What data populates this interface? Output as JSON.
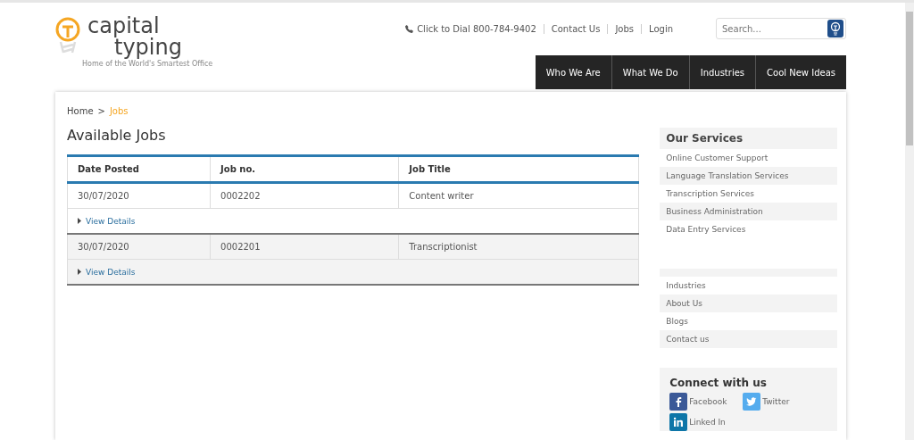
{
  "logo": {
    "word_1": "capital",
    "word_2": "typing",
    "tagline": "Home of the World's Smartest Office"
  },
  "top_links": {
    "phone": "Click to Dial 800-784-9402",
    "links": [
      "Contact Us",
      "Jobs",
      "Login"
    ]
  },
  "search": {
    "placeholder": "Search..."
  },
  "nav": [
    "Who We Are",
    "What We Do",
    "Industries",
    "Cool New Ideas"
  ],
  "breadcrumb": [
    {
      "label": "Home",
      "selected": false
    },
    {
      "label": "Jobs",
      "selected": true
    }
  ],
  "breadcrumb_separator": ">",
  "heading": "Available Jobs",
  "table": {
    "columns": [
      "Date Posted",
      "Job no.",
      "Job Title"
    ],
    "rows": [
      {
        "cells": [
          "30/07/2020",
          "0002202",
          "Content writer"
        ],
        "details": "View Details",
        "shaded": false
      },
      {
        "cells": [
          "30/07/2020",
          "0002201",
          "Transcriptionist"
        ],
        "details": "View Details",
        "shaded": true
      }
    ]
  },
  "services": {
    "title": "Our Services",
    "items": [
      "Online Customer Support",
      "Language Translation Services",
      "Transcription Services",
      "Business Administration",
      "Data Entry Services"
    ]
  },
  "more_links": [
    "Industries",
    "About Us",
    "Blogs",
    "Contact us"
  ],
  "connect": {
    "title": "Connect with us",
    "items": [
      {
        "kind": "facebook",
        "label": "Facebook"
      },
      {
        "kind": "twitter",
        "label": "Twitter"
      },
      {
        "kind": "linkedin",
        "label": "Linked In"
      }
    ]
  }
}
